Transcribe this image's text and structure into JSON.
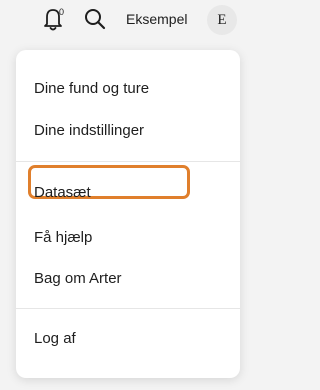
{
  "header": {
    "notification_count": "0",
    "username": "Eksempel",
    "avatar_letter": "E"
  },
  "menu": {
    "items": [
      {
        "label": "Dine fund og ture"
      },
      {
        "label": "Dine indstillinger",
        "highlighted": true
      },
      {
        "label": "Datasæt"
      },
      {
        "label": "Få hjælp"
      },
      {
        "label": "Bag om Arter"
      },
      {
        "label": "Log af"
      }
    ],
    "highlight_color": "#e07f2c"
  },
  "icons": {
    "bell": "bell-icon",
    "search": "search-icon"
  }
}
